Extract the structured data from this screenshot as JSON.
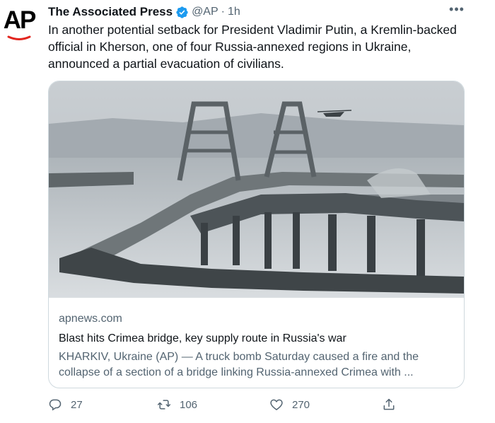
{
  "tweet": {
    "author_name": "The Associated Press",
    "handle": "@AP",
    "separator": "·",
    "time": "1h",
    "avatar_text": "AP",
    "more_label": "•••",
    "text": "In another potential setback for President Vladimir Putin, a Kremlin-backed official in Kherson, one of four Russia-annexed regions in Ukraine, announced a partial evacuation of civilians."
  },
  "card": {
    "domain": "apnews.com",
    "title": "Blast hits Crimea bridge, key supply route in Russia's war",
    "description": "KHARKIV, Ukraine (AP) — A truck bomb Saturday caused a fire and the collapse of a section of a bridge linking Russia-annexed Crimea with ..."
  },
  "actions": {
    "reply_count": "27",
    "retweet_count": "106",
    "like_count": "270"
  },
  "colors": {
    "text_primary": "#0f1419",
    "text_secondary": "#536471",
    "verified_blue": "#1d9bf0",
    "border": "#cfd9de",
    "ap_red": "#e2251e"
  },
  "icons": [
    "verified-badge-icon",
    "more-icon",
    "reply-icon",
    "retweet-icon",
    "like-icon",
    "share-icon"
  ]
}
